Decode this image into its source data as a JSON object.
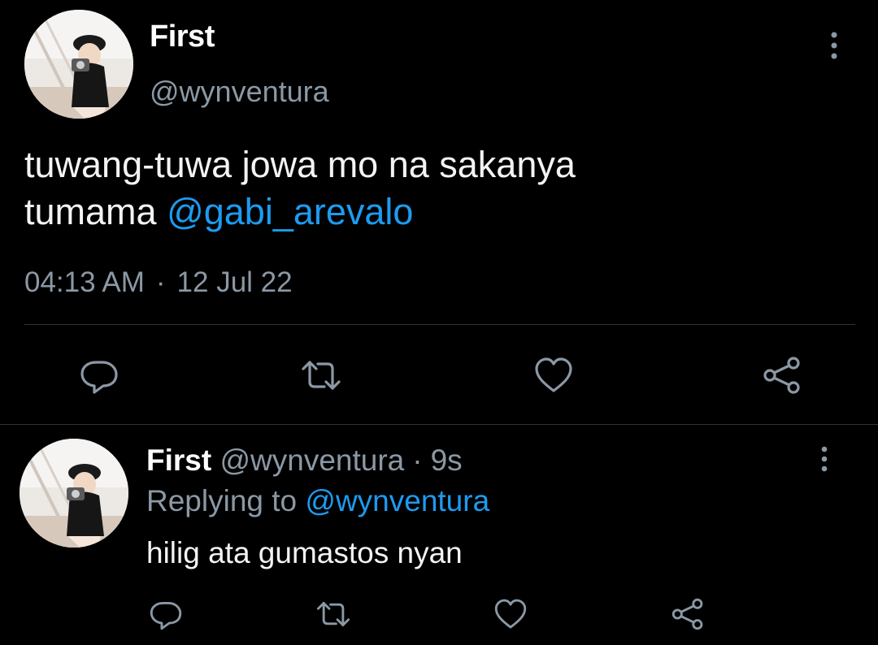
{
  "main_tweet": {
    "avatar_icon": "profile-photo-avatar",
    "display_name": "First",
    "handle": "@wynventura",
    "text_line1": "tuwang-tuwa jowa mo na sakanya",
    "text_line2_prefix": "tumama ",
    "mention": "@gabi_arevalo",
    "time": "04:13 AM",
    "separator": "·",
    "date": "12 Jul 22",
    "more_icon": "vertical-ellipsis-icon",
    "actions": [
      "reply-icon",
      "retweet-icon",
      "like-heart-icon",
      "share-icon"
    ]
  },
  "reply_tweet": {
    "avatar_icon": "profile-photo-avatar",
    "display_name": "First",
    "handle": "@wynventura",
    "separator": "·",
    "time_ago": "9s",
    "replying_prefix": "Replying to ",
    "replying_to": "@wynventura",
    "text": "hilig ata gumastos nyan",
    "more_icon": "vertical-ellipsis-icon",
    "actions": [
      "reply-icon",
      "retweet-icon",
      "like-heart-icon",
      "share-icon"
    ]
  },
  "colors": {
    "background": "#000000",
    "text": "#f3f3f3",
    "secondary_text": "#8b98a5",
    "accent": "#1d9bf0",
    "divider": "#2f3336"
  }
}
